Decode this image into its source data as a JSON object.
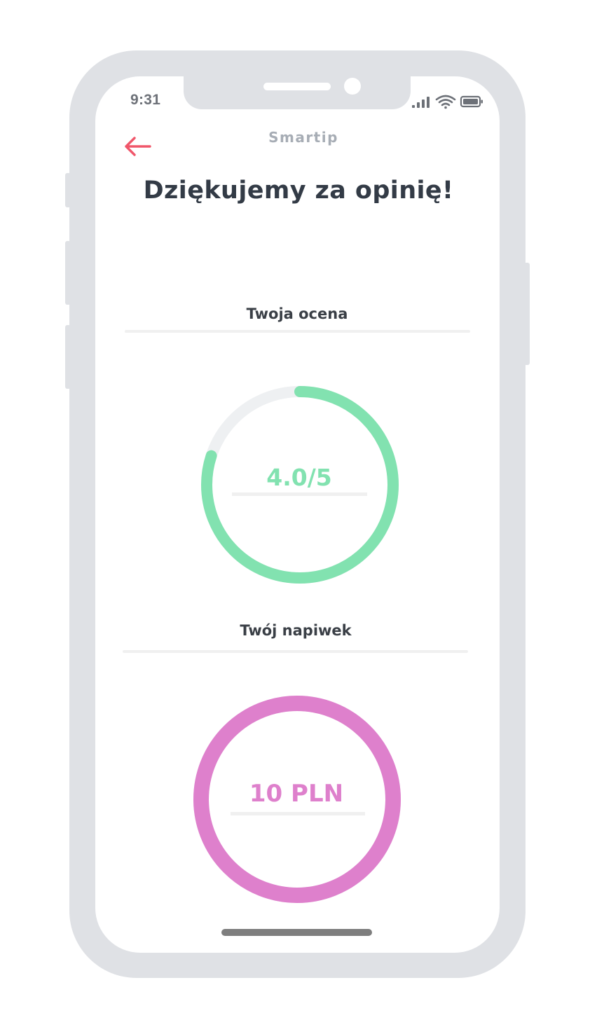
{
  "status_bar": {
    "time": "9:31",
    "icons": [
      "cellular-signal-icon",
      "wifi-icon",
      "battery-icon"
    ]
  },
  "header": {
    "back_icon": "arrow-left-icon",
    "app_title": "Smartip"
  },
  "main": {
    "heading": "Dziękujemy za opinię!",
    "rating": {
      "label": "Twoja ocena",
      "value_text": "4.0/5",
      "progress_fraction": 0.8
    },
    "tip": {
      "label": "Twój napiwek",
      "value_text": "10 PLN",
      "progress_fraction": 1.0
    }
  },
  "colors": {
    "accent_back": "#f0566a",
    "rating_ring": "#82e2b0",
    "rating_track": "#eef0f2",
    "tip_ring": "#de80cc",
    "frame": "#dfe1e5"
  }
}
